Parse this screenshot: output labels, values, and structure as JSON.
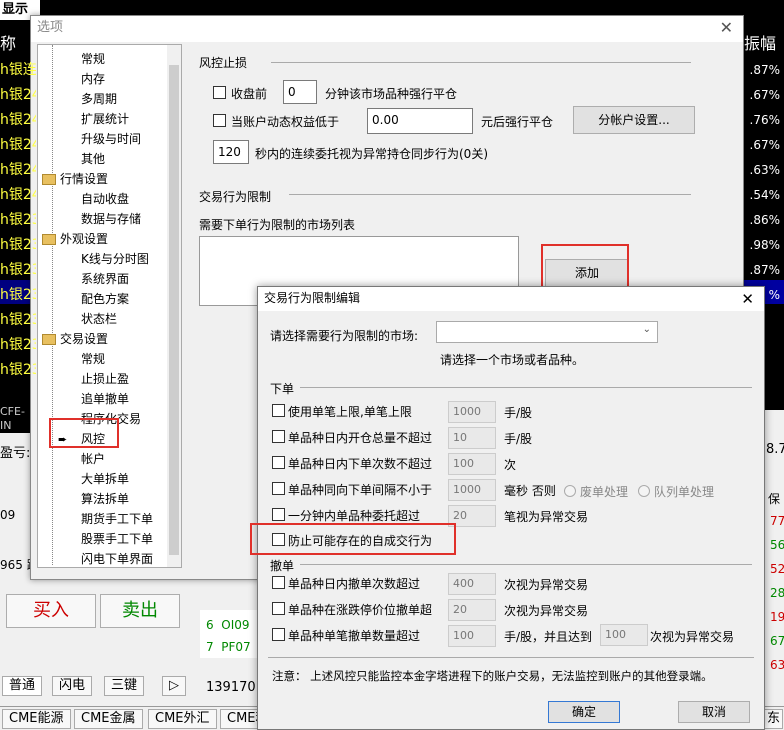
{
  "background": {
    "title": "显示牌",
    "col_header": "称",
    "col_header_right": "振幅",
    "rows": [
      "h银连",
      "h银24",
      "h银24",
      "h银24",
      "h银24",
      "h银24",
      "h银23",
      "h银23",
      "h银23",
      "h银23",
      "h银23",
      "h银23",
      "h银23"
    ],
    "pcts": [
      ".87%",
      ".67%",
      ".76%",
      ".67%",
      ".63%",
      ".54%",
      ".86%",
      ".98%",
      ".87%",
      "%",
      "",
      ""
    ],
    "misc": {
      "cfe": "CFE-IN",
      "ying": "盈亏:",
      "num_1": "8.7",
      "r09": "09",
      "r965": "965 跌",
      "bao": "保"
    },
    "right_nums": [
      "77",
      "56",
      "52",
      "28",
      "19",
      "67",
      "63"
    ],
    "left_labels": [
      "买入",
      "卖出"
    ],
    "mid_list": [
      {
        "n": "6",
        "code": "OI09"
      },
      {
        "n": "7",
        "code": "PF07"
      }
    ],
    "phone": "1391701",
    "bottom_tabs": [
      "普通",
      "闪电",
      "三键",
      "▷"
    ],
    "cme_tabs": [
      "CME能源",
      "CME金属",
      "CME外汇",
      "CME利",
      "东"
    ]
  },
  "options": {
    "title": "选项",
    "close": "✕",
    "tree": {
      "general": [
        "常规",
        "内存",
        "多周期",
        "扩展统计",
        "升级与时间",
        "其他"
      ],
      "quote_group": "行情设置",
      "quote": [
        "自动收盘",
        "数据与存储"
      ],
      "look_group": "外观设置",
      "look": [
        "K线与分时图",
        "系统界面",
        "配色方案",
        "状态栏"
      ],
      "trade_group": "交易设置",
      "trade": [
        "常规",
        "止损止盈",
        "追单撤单",
        "程序化交易",
        "风控",
        "帐户",
        "大单拆单",
        "算法拆单",
        "期货手工下单",
        "股票手工下单",
        "闪电下单界面"
      ]
    },
    "risk": {
      "section": "风控止损",
      "close_before": "收盘前",
      "close_before_val": "0",
      "close_before_suffix": "分钟该市场品种强行平仓",
      "equity_below": "当账户动态权益低于",
      "equity_val": "0.00",
      "equity_suffix": "元后强行平仓",
      "sub_account_btn": "分帐户设置...",
      "seconds_val": "120",
      "seconds_suffix": "秒内的连续委托视为异常持仓同步行为(0关)"
    },
    "trade_limit": {
      "section": "交易行为限制",
      "list_label": "需要下单行为限制的市场列表",
      "add_btn": "添加"
    }
  },
  "sub": {
    "title": "交易行为限制编辑",
    "close": "✕",
    "market_label": "请选择需要行为限制的市场:",
    "market_value": "",
    "hint": "请选择一个市场或者品种。",
    "order_section": "下单",
    "items": [
      {
        "label": "使用单笔上限,单笔上限",
        "val": "1000",
        "unit": "手/股"
      },
      {
        "label": "单品种日内开仓总量不超过",
        "val": "10",
        "unit": "手/股"
      },
      {
        "label": "单品种日内下单次数不超过",
        "val": "100",
        "unit": "次"
      },
      {
        "label": "单品种同向下单间隔不小于",
        "val": "1000",
        "unit": "毫秒  否则"
      },
      {
        "label": "一分钟内单品种委托超过",
        "val": "20",
        "unit": "笔视为异常交易"
      }
    ],
    "radio_a": "废单处理",
    "radio_b": "队列单处理",
    "self_trade": "防止可能存在的自成交行为",
    "cancel_section": "撤单",
    "cancel_items": [
      {
        "label": "单品种日内撤单次数超过",
        "val": "400",
        "unit": "次视为异常交易"
      },
      {
        "label": "单品种在涨跌停价位撤单超",
        "val": "20",
        "unit": "次视为异常交易"
      },
      {
        "label": "单品种单笔撤单数量超过",
        "val": "100",
        "unit": "手/股，并且达到"
      }
    ],
    "cancel_extra_val": "100",
    "cancel_extra_unit": "次视为异常交易",
    "note": "注意：   上述风控只能监控本金字塔进程下的账户交易，无法监控到账户的其他登录端。",
    "ok": "确定",
    "cancel": "取消"
  }
}
